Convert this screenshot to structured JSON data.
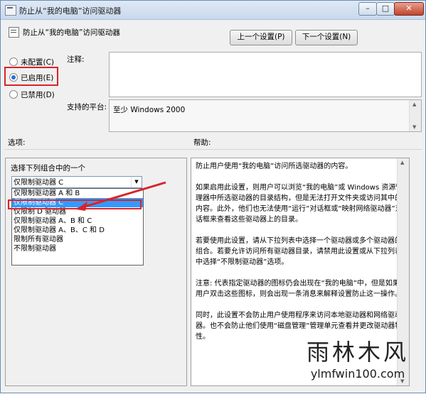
{
  "window": {
    "title": "防止从“我的电脑”访问驱动器",
    "min_label": "–",
    "max_label": "□",
    "close_label": "✕"
  },
  "header": {
    "policy_title": "防止从“我的电脑”访问驱动器",
    "prev_button": "上一个设置(P)",
    "next_button": "下一个设置(N)"
  },
  "state": {
    "not_configured": "未配置(C)",
    "enabled": "已启用(E)",
    "disabled": "已禁用(D)",
    "selected": "enabled"
  },
  "comment_label": "注释:",
  "comment_value": "",
  "platform_label": "支持的平台:",
  "platform_value": "至少 Windows 2000",
  "options_label": "选项:",
  "help_label": "帮助:",
  "options": {
    "combo_label": "选择下列组合中的一个",
    "combo_value": "仅限制驱动器 C",
    "dropdown_items": [
      "仅限制驱动器 A 和 B",
      "仅限制驱动器 C",
      "仅限制 D 驱动器",
      "仅限制驱动器 A、B 和 C",
      "仅限制驱动器 A、B、C 和 D",
      "限制所有驱动器",
      "不限制驱动器"
    ],
    "selected_index": 1
  },
  "help": {
    "paragraphs": [
      "防止用户使用“我的电脑”访问所选驱动器的内容。",
      "如果启用此设置，则用户可以浏览“我的电脑”或 Windows 资源管理器中所选驱动器的目录结构，但是无法打开文件夹或访问其中的内容。此外，他们也无法使用“运行”对话框或“映射网络驱动器”对话框来查看这些驱动器上的目录。",
      "若要使用此设置，请从下拉列表中选择一个驱动器或多个驱动器的组合。若要允许访问所有驱动器目录，请禁用此设置或从下拉列表中选择“不限制驱动器”选项。",
      "注意: 代表指定驱动器的图标仍会出现在“我的电脑”中，但是如果用户双击这些图标，则会出现一条消息来解释设置防止这一操作。",
      "同时，此设置不会防止用户使用程序来访问本地驱动器和网络驱动器。也不会防止他们使用“磁盘管理”管理单元查看并更改驱动器特性。"
    ]
  },
  "watermark": {
    "cn": "雨林木风",
    "en": "ylmfwin100.com"
  },
  "colors": {
    "highlight": "#d8232a",
    "selection": "#3399ff"
  }
}
